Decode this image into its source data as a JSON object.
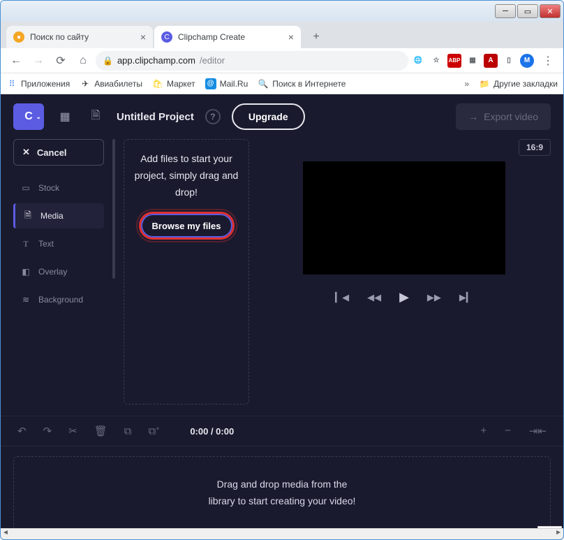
{
  "window": {
    "tabs": [
      {
        "title": "Поиск по сайту",
        "favicon_color": "#f5a623",
        "active": false
      },
      {
        "title": "Clipchamp Create",
        "favicon_color": "#5b5ce2",
        "active": true
      }
    ]
  },
  "browser": {
    "url_host": "app.clipchamp.com",
    "url_path": "/editor",
    "bookmarks": [
      {
        "label": "Приложения",
        "icon": "⋮⋮⋮"
      },
      {
        "label": "Авиабилеты",
        "icon": "✈"
      },
      {
        "label": "Маркет",
        "icon": "🛒"
      },
      {
        "label": "Mail.Ru",
        "icon": "@"
      },
      {
        "label": "Поиск в Интернете",
        "icon": "🔍"
      }
    ],
    "other_bookmarks": "Другие закладки",
    "overflow": "»"
  },
  "extensions": {
    "translate": "⇄",
    "star": "☆",
    "abp": "ABP",
    "dots": "⋮⋮",
    "pdf": "A",
    "profile": "M"
  },
  "app": {
    "logo": "C",
    "project_title": "Untitled Project",
    "upgrade": "Upgrade",
    "export": "Export video",
    "cancel": "Cancel",
    "sidebar": [
      {
        "key": "stock",
        "label": "Stock",
        "icon": "▭"
      },
      {
        "key": "media",
        "label": "Media",
        "icon": "🗎",
        "active": true
      },
      {
        "key": "text",
        "label": "Text",
        "icon": "T"
      },
      {
        "key": "overlay",
        "label": "Overlay",
        "icon": "◧"
      },
      {
        "key": "background",
        "label": "Background",
        "icon": "≋"
      }
    ],
    "media_panel": {
      "text": "Add files to start your project, simply drag and drop!",
      "browse": "Browse my files"
    },
    "preview": {
      "ratio": "16:9"
    },
    "timeline": {
      "time": "0:00 / 0:00",
      "drop_text_1": "Drag and drop media from the",
      "drop_text_2": "library to start creating your video!"
    },
    "null_label": "null"
  }
}
